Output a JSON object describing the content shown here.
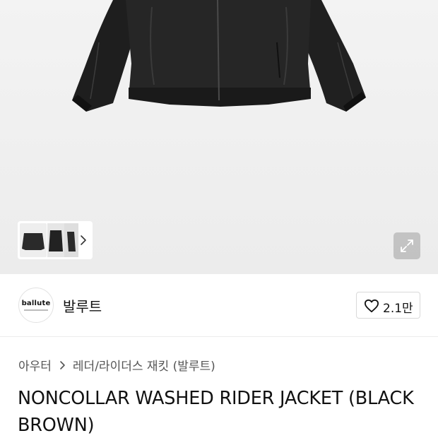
{
  "gallery": {
    "icons": {
      "thumb_next": "chevron-right-icon",
      "expand": "expand-arrows-icon"
    },
    "colors": {
      "background": "#eeeeee",
      "expand_button": "#a0a0a0"
    }
  },
  "brand": {
    "logo_text": "ballute",
    "name": "발루트",
    "likes": "2.1만",
    "like_icon": "heart-outline-icon"
  },
  "breadcrumb": {
    "parent": "아우터",
    "separator_icon": "chevron-right-icon",
    "current": "레더/라이더스 재킷 (발루트)"
  },
  "product": {
    "title": "NONCOLLAR WASHED RIDER JACKET (BLACK BROWN)"
  }
}
